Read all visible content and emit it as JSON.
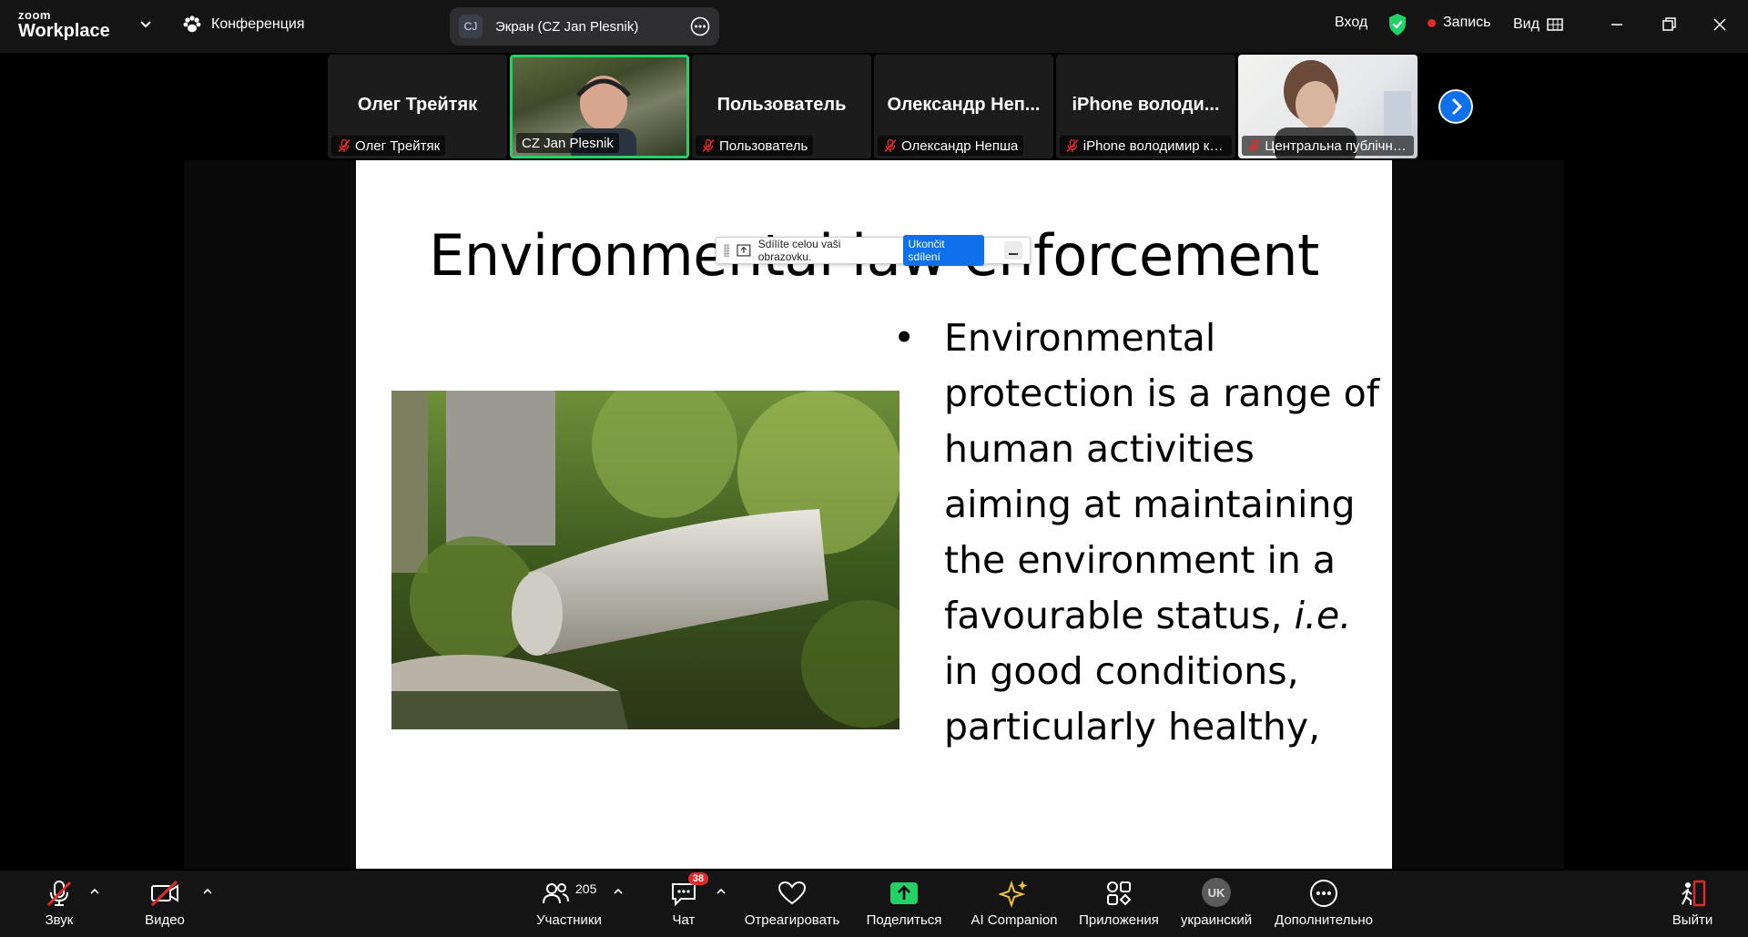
{
  "colors": {
    "accent_green": "#22d267",
    "brand_blue": "#0e71eb",
    "record_red": "#e02b2b"
  },
  "app": {
    "logo_top": "zoom",
    "logo_bottom": "Workplace"
  },
  "meeting": {
    "label": "Конференция",
    "icon": "meeting-paw-icon"
  },
  "share_indicator": {
    "badge": "CJ",
    "label": "Экран (CZ Jan Plesnik)"
  },
  "top_right": {
    "signin": "Вход",
    "record": "Запись",
    "view": "Вид"
  },
  "gallery": [
    {
      "big_name": "Олег Трейтяк",
      "tag": "Олег Трейтяк",
      "video": false,
      "muted": true,
      "active": false
    },
    {
      "big_name": "",
      "tag": "CZ Jan Plesnik",
      "video": true,
      "muted": false,
      "active": true
    },
    {
      "big_name": "Пользователь",
      "tag": "Пользователь",
      "video": false,
      "muted": true,
      "active": false
    },
    {
      "big_name": "Олександр Неп...",
      "tag": "Олександр Непша",
      "video": false,
      "muted": true,
      "active": false
    },
    {
      "big_name": "iPhone володи...",
      "tag": "iPhone володимир ко...",
      "video": false,
      "muted": true,
      "active": false
    },
    {
      "big_name": "",
      "tag": "Центральна публічна ...",
      "video": true,
      "muted": true,
      "active": false
    }
  ],
  "slide": {
    "title": "Environmental law enforcement",
    "bullet_main": "Environmental protection is a range of human activities aiming at maintaining the environment in a favourable status, ",
    "bullet_italic": "i.e.",
    "bullet_tail": " in good conditions, particularly healthy,"
  },
  "share_toolbar": {
    "text": "Sdílíte celou vaši obrazovku.",
    "stop": "Ukončit sdílení"
  },
  "toolbar": {
    "audio": "Звук",
    "video": "Видео",
    "participants": "Участники",
    "participants_count": "205",
    "chat": "Чат",
    "chat_badge": "38",
    "react": "Отреагировать",
    "share": "Поделиться",
    "ai": "AI Companion",
    "apps": "Приложения",
    "language_code": "UK",
    "language": "украинский",
    "more": "Дополнительно",
    "leave": "Выйти"
  }
}
